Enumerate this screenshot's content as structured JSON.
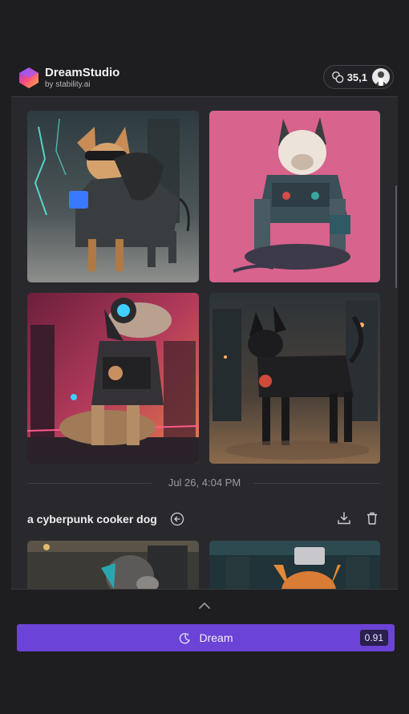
{
  "app": {
    "title": "DreamStudio",
    "subtitle": "by stability.ai"
  },
  "credits": {
    "value": "35,1",
    "icon": "coins-icon"
  },
  "gallery": {
    "batch1": [
      {
        "alt": "cyberpunk dog with goggles"
      },
      {
        "alt": "cyberpunk bulldog on pink"
      },
      {
        "alt": "cyberpunk dog with headphones"
      },
      {
        "alt": "black cyberpunk dog in city"
      }
    ],
    "date": "Jul 26, 4:04 PM",
    "batch2_prompt": "a cyberpunk cooker dog"
  },
  "dream": {
    "label": "Dream",
    "cost": "0.91"
  },
  "colors": {
    "accent": "#6b43d6",
    "background": "#1e1e20",
    "panel": "#29292d"
  }
}
